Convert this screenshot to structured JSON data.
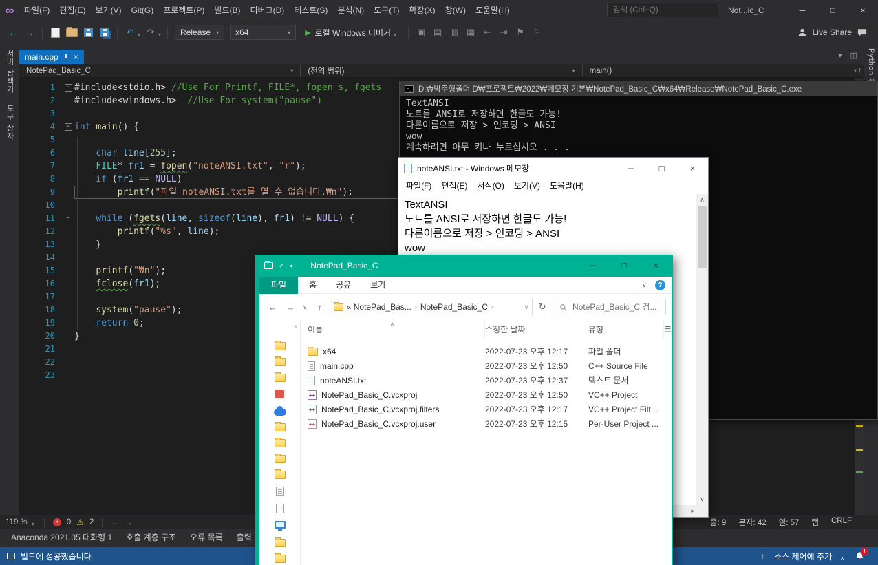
{
  "icons": {
    "vs_logo": "∞",
    "minimize": "─",
    "maximize": "□",
    "close": "×",
    "back_arrow": "←",
    "forward_arrow": "→",
    "dropdown_caret": "▾",
    "undo": "↶",
    "redo": "↷",
    "play": "▶",
    "up_arrow": "↑",
    "refresh": "↻",
    "chevron_down": "∨",
    "chevron_up": "∧",
    "crumb_separator": "›",
    "scroll_up": "∧",
    "scroll_down": "∨",
    "scroll_left": "◂",
    "scroll_right": "▸",
    "warning": "⚠",
    "error_x": "×",
    "splitter": "↕",
    "doc_well_caret": "▾",
    "float_window": "◫",
    "cmd_prompt": ">_",
    "help": "?",
    "check": "✓",
    "sort_asc": "∧"
  },
  "vs": {
    "window_title": "Not...ic_C",
    "menus": [
      "파일(F)",
      "편집(E)",
      "보기(V)",
      "Git(G)",
      "프로젝트(P)",
      "빌드(B)",
      "디버그(D)",
      "테스트(S)",
      "분석(N)",
      "도구(T)",
      "확장(X)",
      "창(W)",
      "도움말(H)"
    ],
    "search_placeholder": "검색 (Ctrl+Q)",
    "left_tool_tabs": [
      "서버 탐색기",
      "도구 상자"
    ],
    "right_tool_tabs": [
      "Python 환경"
    ],
    "toolbar": {
      "configuration": "Release",
      "platform": "x64",
      "debug_target": "로컬 Windows 디버거",
      "live_share": "Live Share",
      "extra_icons": [
        {
          "name": "browse-web-icon",
          "glyph": "▣"
        },
        {
          "name": "camera-icon",
          "glyph": "▤"
        },
        {
          "name": "comment-out-icon",
          "glyph": "▥"
        },
        {
          "name": "uncomment-icon",
          "glyph": "▦"
        },
        {
          "name": "decrease-indent-icon",
          "glyph": "⇤"
        },
        {
          "name": "increase-indent-icon",
          "glyph": "⇥"
        },
        {
          "name": "toggle-bookmark-icon",
          "glyph": "⚑"
        },
        {
          "name": "bookmark-list-icon",
          "glyph": "⚐"
        }
      ]
    },
    "document_tab": "main.cpp",
    "breadcrumb": [
      "NotePad_Basic_C",
      "(전역 범위)",
      "main()"
    ],
    "editor": {
      "lines": [
        {
          "n": 1,
          "fold": true,
          "segs": [
            [
              "pp",
              "#include"
            ],
            [
              "pl",
              "<stdio.h> "
            ],
            [
              "co",
              "//Use For Printf, FILE*, fopen_s, fgets"
            ]
          ]
        },
        {
          "n": 2,
          "segs": [
            [
              "pp",
              "#include"
            ],
            [
              "pl",
              "<windows.h>  "
            ],
            [
              "co",
              "//Use For system(\"pause\")"
            ]
          ]
        },
        {
          "n": 3,
          "segs": []
        },
        {
          "n": 4,
          "fold": true,
          "segs": [
            [
              "kw",
              "int"
            ],
            [
              "pl",
              " "
            ],
            [
              "fn",
              "main"
            ],
            [
              "pl",
              "() {"
            ]
          ]
        },
        {
          "n": 5,
          "segs": []
        },
        {
          "n": 6,
          "segs": [
            [
              "pl",
              "    "
            ],
            [
              "kw",
              "char"
            ],
            [
              "pl",
              " "
            ],
            [
              "va",
              "line"
            ],
            [
              "pl",
              "["
            ],
            [
              "nu",
              "255"
            ],
            [
              "pl",
              "];"
            ]
          ]
        },
        {
          "n": 7,
          "segs": [
            [
              "pl",
              "    "
            ],
            [
              "ty",
              "FILE"
            ],
            [
              "pl",
              "* "
            ],
            [
              "va",
              "fr1"
            ],
            [
              "pl",
              " = "
            ],
            [
              "fn",
              "fopen",
              "sq"
            ],
            [
              "pl",
              "("
            ],
            [
              "st",
              "\"noteANSI.txt\""
            ],
            [
              "pl",
              ", "
            ],
            [
              "st",
              "\"r\""
            ],
            [
              "pl",
              ");"
            ]
          ]
        },
        {
          "n": 8,
          "segs": [
            [
              "pl",
              "    "
            ],
            [
              "kw",
              "if"
            ],
            [
              "pl",
              " ("
            ],
            [
              "va",
              "fr1"
            ],
            [
              "pl",
              " == "
            ],
            [
              "ma",
              "NULL"
            ],
            [
              "pl",
              ")"
            ]
          ]
        },
        {
          "n": 9,
          "current": true,
          "segs": [
            [
              "pl",
              "        "
            ],
            [
              "fn",
              "printf"
            ],
            [
              "pl",
              "("
            ],
            [
              "st",
              "\"파일 noteANSI.txt를 열 수 없습니다.₩n\""
            ],
            [
              "pl",
              ");"
            ]
          ]
        },
        {
          "n": 10,
          "segs": []
        },
        {
          "n": 11,
          "fold": true,
          "segs": [
            [
              "pl",
              "    "
            ],
            [
              "kw",
              "while"
            ],
            [
              "pl",
              " ("
            ],
            [
              "fn",
              "fgets",
              "sq"
            ],
            [
              "pl",
              "("
            ],
            [
              "va",
              "line"
            ],
            [
              "pl",
              ", "
            ],
            [
              "kw",
              "sizeof"
            ],
            [
              "pl",
              "("
            ],
            [
              "va",
              "line"
            ],
            [
              "pl",
              "), "
            ],
            [
              "va",
              "fr1"
            ],
            [
              "pl",
              ") != "
            ],
            [
              "ma",
              "NULL"
            ],
            [
              "pl",
              ") {"
            ]
          ]
        },
        {
          "n": 12,
          "segs": [
            [
              "pl",
              "        "
            ],
            [
              "fn",
              "printf"
            ],
            [
              "pl",
              "("
            ],
            [
              "st",
              "\"%s\""
            ],
            [
              "pl",
              ", "
            ],
            [
              "va",
              "line"
            ],
            [
              "pl",
              ");"
            ]
          ]
        },
        {
          "n": 13,
          "segs": [
            [
              "pl",
              "    }"
            ]
          ]
        },
        {
          "n": 14,
          "segs": []
        },
        {
          "n": 15,
          "segs": [
            [
              "pl",
              "    "
            ],
            [
              "fn",
              "printf"
            ],
            [
              "pl",
              "("
            ],
            [
              "st",
              "\"₩n\""
            ],
            [
              "pl",
              ");"
            ]
          ]
        },
        {
          "n": 16,
          "segs": [
            [
              "pl",
              "    "
            ],
            [
              "fn",
              "fclose",
              "sq"
            ],
            [
              "pl",
              "("
            ],
            [
              "va",
              "fr1"
            ],
            [
              "pl",
              ");"
            ]
          ]
        },
        {
          "n": 17,
          "segs": []
        },
        {
          "n": 18,
          "segs": [
            [
              "pl",
              "    "
            ],
            [
              "fn",
              "system"
            ],
            [
              "pl",
              "("
            ],
            [
              "st",
              "\"pause\""
            ],
            [
              "pl",
              ");"
            ]
          ]
        },
        {
          "n": 19,
          "segs": [
            [
              "pl",
              "    "
            ],
            [
              "kw",
              "return"
            ],
            [
              "pl",
              " "
            ],
            [
              "nu",
              "0"
            ],
            [
              "pl",
              ";"
            ]
          ]
        },
        {
          "n": 20,
          "segs": [
            [
              "pl",
              "}"
            ]
          ]
        },
        {
          "n": 21,
          "segs": []
        },
        {
          "n": 22,
          "segs": []
        },
        {
          "n": 23,
          "segs": []
        }
      ]
    },
    "editor_status": {
      "zoom": "119 %",
      "error_count": "0",
      "warning_count": "2",
      "line": "줄: 9",
      "character": "문자: 42",
      "column": "열: 57",
      "indent_mode": "탭",
      "line_ending": "CRLF"
    },
    "panel_tabs": [
      "Anaconda 2021.05 대화형 1",
      "호출 계층 구조",
      "오류 목록",
      "출력"
    ],
    "status_bar": {
      "message": "빌드에 성공했습니다.",
      "add_to_source_control": "소스 제어에 추가",
      "notification_count": "1"
    }
  },
  "console": {
    "title": "D:₩박주형폴더 D₩프로젝트₩2022₩메모장 기본₩NotePad_Basic_C₩x64₩Release₩NotePad_Basic_C.exe",
    "lines": [
      "TextANSI",
      "노트를 ANSI로 저장하면 한글도 가능!",
      "다른이름으로 저장 > 인코딩 > ANSI",
      "wow",
      "계속하려면 아무 키나 누르십시오 . . ."
    ]
  },
  "notepad": {
    "title": "noteANSI.txt - Windows 메모장",
    "menus": [
      "파일(F)",
      "편집(E)",
      "서식(O)",
      "보기(V)",
      "도움말(H)"
    ],
    "lines": [
      "TextANSI",
      "노트를 ANSI로 저장하면 한글도 가능!",
      "다른이름으로 저장 > 인코딩 > ANSI",
      "wow"
    ]
  },
  "explorer": {
    "title": "NotePad_Basic_C",
    "ribbon_tabs": [
      "파일",
      "홈",
      "공유",
      "보기"
    ],
    "address_segments": [
      "« NotePad_Bas...",
      "NotePad_Basic_C"
    ],
    "search_placeholder": "NotePad_Basic_C 검...",
    "columns": [
      "이름",
      "수정한 날짜",
      "유형",
      "크기"
    ],
    "files": [
      {
        "name": "x64",
        "date": "2022-07-23 오후 12:17",
        "type": "파일 폴더",
        "icon": "folder"
      },
      {
        "name": "main.cpp",
        "date": "2022-07-23 오후 12:50",
        "type": "C++ Source File",
        "icon": "cpp"
      },
      {
        "name": "noteANSI.txt",
        "date": "2022-07-23 오후 12:37",
        "type": "텍스트 문서",
        "icon": "text"
      },
      {
        "name": "NotePad_Basic_C.vcxproj",
        "date": "2022-07-23 오후 12:50",
        "type": "VC++ Project",
        "icon": "vcxproj"
      },
      {
        "name": "NotePad_Basic_C.vcxproj.filters",
        "date": "2022-07-23 오후 12:17",
        "type": "VC++ Project Filt...",
        "icon": "filters"
      },
      {
        "name": "NotePad_Basic_C.vcxproj.user",
        "date": "2022-07-23 오후 12:15",
        "type": "Per-User Project ...",
        "icon": "user"
      }
    ],
    "nav_icons": [
      "folder",
      "folder",
      "folder",
      "red",
      "cloud",
      "folder",
      "folder",
      "folder",
      "folder",
      "doc",
      "doc",
      "monitor",
      "folder",
      "folder"
    ]
  }
}
